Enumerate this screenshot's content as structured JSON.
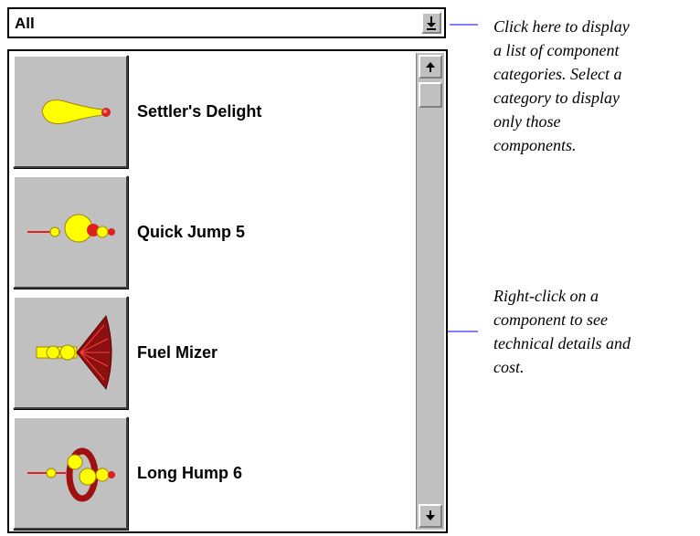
{
  "dropdown": {
    "value": "All"
  },
  "list": {
    "items": [
      {
        "name": "Settler's Delight",
        "icon": "engine-settlers-delight-icon"
      },
      {
        "name": "Quick Jump 5",
        "icon": "engine-quick-jump-icon"
      },
      {
        "name": "Fuel Mizer",
        "icon": "engine-fuel-mizer-icon"
      },
      {
        "name": "Long Hump 6",
        "icon": "engine-long-hump-icon"
      }
    ]
  },
  "callouts": {
    "dropdown_help": [
      "Click here to display",
      "a list of component",
      "categories. Select a",
      "category to display",
      "only those",
      "components."
    ],
    "rightclick_help": [
      "Right-click on a",
      "component to see",
      "technical details and",
      "cost."
    ]
  },
  "colors": {
    "callout_line": "#0000ff",
    "panel_gray": "#c0c0c0"
  }
}
